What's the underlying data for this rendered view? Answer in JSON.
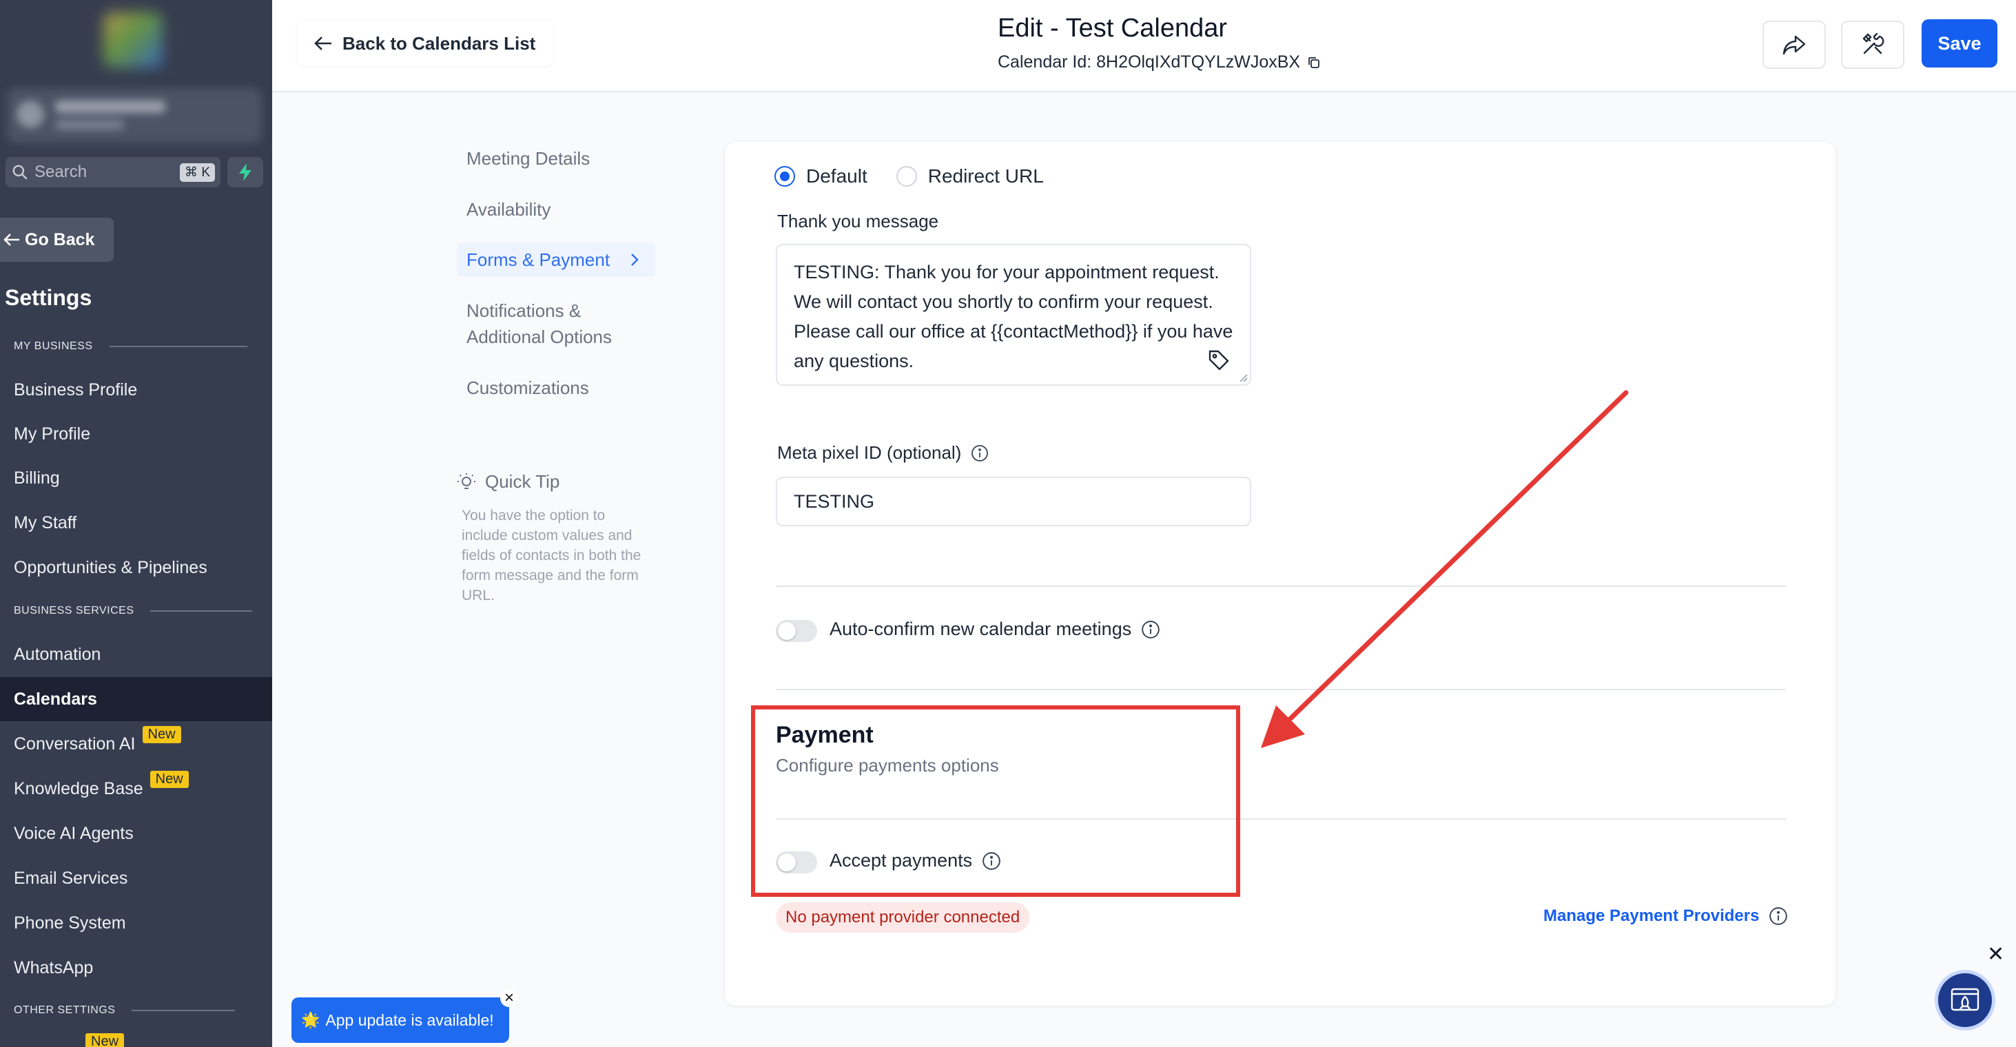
{
  "sidebar": {
    "search_placeholder": "Search",
    "search_shortcut": "⌘ K",
    "go_back": "Go Back",
    "title": "Settings",
    "sections": {
      "my_business": "MY BUSINESS",
      "business_services": "BUSINESS SERVICES",
      "other_settings": "OTHER SETTINGS"
    },
    "items": {
      "business_profile": "Business Profile",
      "my_profile": "My Profile",
      "billing": "Billing",
      "my_staff": "My Staff",
      "opportunities": "Opportunities & Pipelines",
      "automation": "Automation",
      "calendars": "Calendars",
      "conversation_ai": "Conversation AI",
      "knowledge_base": "Knowledge Base",
      "voice_ai": "Voice AI Agents",
      "email_services": "Email Services",
      "phone_system": "Phone System",
      "whatsapp": "WhatsApp"
    },
    "new_badge": "New",
    "active_item": "Calendars"
  },
  "header": {
    "back_label": "Back to Calendars List",
    "title": "Edit - Test Calendar",
    "calendar_id_label": "Calendar Id: 8H2OlqIXdTQYLzWJoxBX",
    "save_label": "Save"
  },
  "subnav": {
    "items": [
      "Meeting Details",
      "Availability",
      "Forms & Payment",
      "Notifications &",
      "Additional Options",
      "Customizations"
    ],
    "active": "Forms & Payment",
    "tip_title": "Quick Tip",
    "tip_body": "You have the option to include custom values and fields of contacts in both the form message and the form URL."
  },
  "form": {
    "radio_default": "Default",
    "radio_redirect": "Redirect URL",
    "selected_option": "Default",
    "thank_you_label": "Thank you message",
    "thank_you_value": "TESTING: Thank you for your appointment request. We will contact you shortly to confirm your request. Please call our office at {{contactMethod}} if you have any questions.",
    "meta_pixel_label": "Meta pixel ID (optional)",
    "meta_pixel_value": "TESTING",
    "auto_confirm_label": "Auto-confirm new calendar meetings",
    "auto_confirm_enabled": false
  },
  "payment": {
    "title": "Payment",
    "subtitle": "Configure payments options",
    "accept_label": "Accept payments",
    "accept_enabled": false,
    "error_badge": "No payment provider connected",
    "manage_link": "Manage Payment Providers"
  },
  "toast": {
    "text": "App update is available!"
  },
  "colors": {
    "sidebar_bg": "#363d4f",
    "accent": "#155eef",
    "annotation_red": "#e53935",
    "error_text": "#b42318"
  }
}
